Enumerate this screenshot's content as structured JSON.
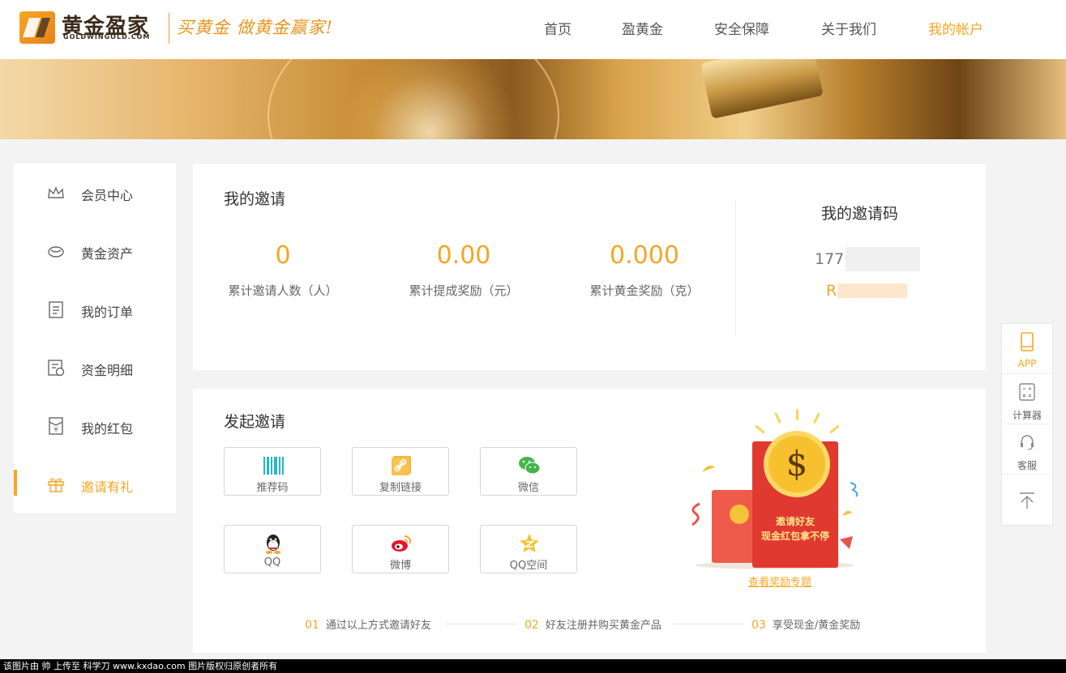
{
  "header": {
    "logo_cn": "黄金盈家",
    "logo_en": "GOLDWINGOLD.COM",
    "slogan": "买黄金  做黄金赢家!",
    "nav": [
      {
        "label": "首页",
        "active": false
      },
      {
        "label": "盈黄金",
        "active": false
      },
      {
        "label": "安全保障",
        "active": false
      },
      {
        "label": "关于我们",
        "active": false
      },
      {
        "label": "我的帐户",
        "active": true
      }
    ]
  },
  "sidebar": {
    "items": [
      {
        "label": "会员中心",
        "icon": "crown-icon",
        "active": false
      },
      {
        "label": "黄金资产",
        "icon": "gold-ingot-icon",
        "active": false
      },
      {
        "label": "我的订单",
        "icon": "order-list-icon",
        "active": false
      },
      {
        "label": "资金明细",
        "icon": "fund-detail-icon",
        "active": false
      },
      {
        "label": "我的红包",
        "icon": "red-packet-icon",
        "active": false
      },
      {
        "label": "邀请有礼",
        "icon": "gift-icon",
        "active": true
      }
    ]
  },
  "invite_summary": {
    "title": "我的邀请",
    "stats": [
      {
        "value": "0",
        "label": "累计邀请人数（人）"
      },
      {
        "value": "0.00",
        "label": "累计提成奖励（元）"
      },
      {
        "value": "0.000",
        "label": "累计黄金奖励（克）"
      }
    ],
    "code_title": "我的邀请码",
    "code_number": "177",
    "code_prefix": "R"
  },
  "start_invite": {
    "title": "发起邀请",
    "buttons": [
      {
        "label": "推荐码",
        "icon": "barcode-icon"
      },
      {
        "label": "复制链接",
        "icon": "link-icon"
      },
      {
        "label": "微信",
        "icon": "wechat-icon"
      },
      {
        "label": "QQ",
        "icon": "qq-icon"
      },
      {
        "label": "微博",
        "icon": "weibo-icon"
      },
      {
        "label": "QQ空间",
        "icon": "qzone-icon"
      }
    ],
    "promo_line1": "邀请好友",
    "promo_line2": "现金红包拿不停",
    "promo_link": "查看奖励专题",
    "steps": [
      {
        "num": "01",
        "text": "通过以上方式邀请好友"
      },
      {
        "num": "02",
        "text": "好友注册并购买黄金产品"
      },
      {
        "num": "03",
        "text": "享受现金/黄金奖励"
      }
    ]
  },
  "float_tools": [
    {
      "label": "APP",
      "icon": "phone-icon",
      "active": true
    },
    {
      "label": "计算器",
      "icon": "calculator-icon",
      "active": false
    },
    {
      "label": "客服",
      "icon": "headset-icon",
      "active": false
    },
    {
      "label": "",
      "icon": "back-to-top-icon",
      "active": false
    }
  ],
  "watermark": "该图片由  帅  上传至  科学刀  www.kxdao.com  图片版权归原创者所有",
  "colors": {
    "accent": "#f5a623",
    "envelope_red": "#e0392f",
    "coin_gold": "#f7c02e"
  }
}
